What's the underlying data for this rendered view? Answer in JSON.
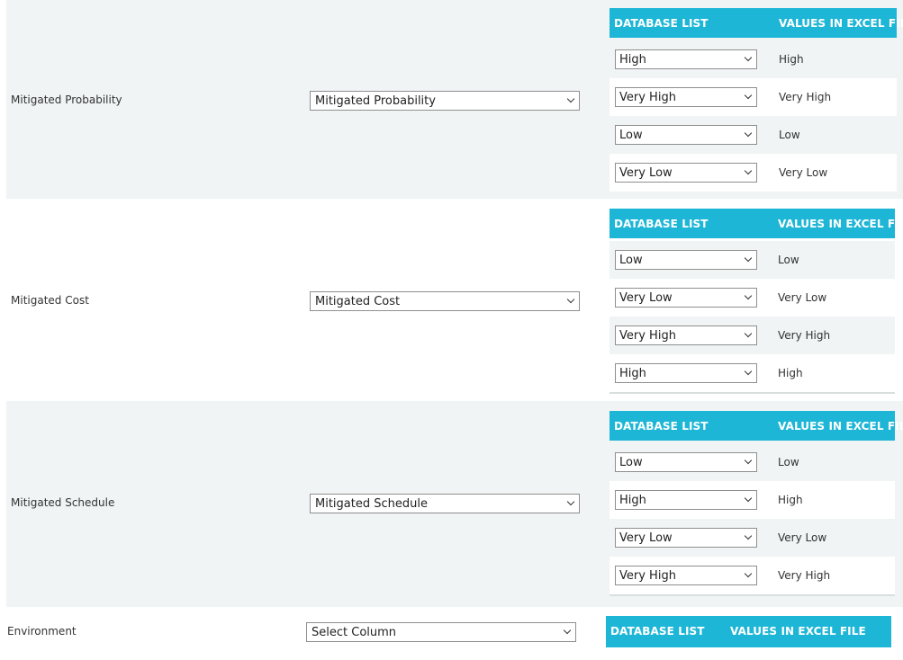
{
  "headers": {
    "database_list": "DATABASE LIST",
    "values_in_excel": "VALUES IN EXCEL FILE"
  },
  "fields": [
    {
      "label": "Mitigated Probability",
      "selected_column": "Mitigated Probability",
      "mappings": [
        {
          "db": "High",
          "excel": "High"
        },
        {
          "db": "Very High",
          "excel": "Very High"
        },
        {
          "db": "Low",
          "excel": "Low"
        },
        {
          "db": "Very Low",
          "excel": "Very Low"
        }
      ]
    },
    {
      "label": "Mitigated Cost",
      "selected_column": "Mitigated Cost",
      "mappings": [
        {
          "db": "Low",
          "excel": "Low"
        },
        {
          "db": "Very Low",
          "excel": "Very Low"
        },
        {
          "db": "Very High",
          "excel": "Very High"
        },
        {
          "db": "High",
          "excel": "High"
        }
      ]
    },
    {
      "label": "Mitigated Schedule",
      "selected_column": "Mitigated Schedule",
      "mappings": [
        {
          "db": "Low",
          "excel": "Low"
        },
        {
          "db": "High",
          "excel": "High"
        },
        {
          "db": "Very Low",
          "excel": "Very Low"
        },
        {
          "db": "Very High",
          "excel": "Very High"
        }
      ]
    },
    {
      "label": "Environment",
      "selected_column": "Select Column",
      "mappings": []
    }
  ]
}
